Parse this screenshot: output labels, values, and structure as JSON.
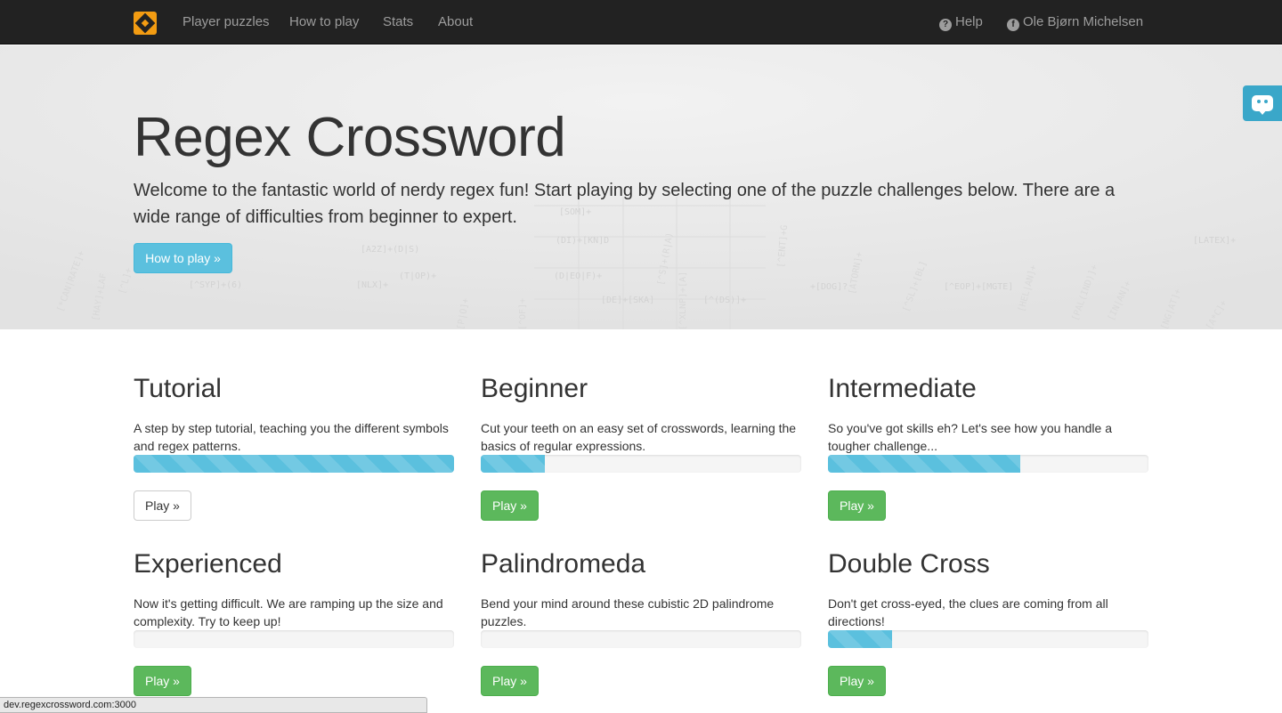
{
  "navbar": {
    "brand_icon": "regex-crossword-logo-icon",
    "links": [
      "Player puzzles",
      "How to play",
      "Stats",
      "About"
    ],
    "help_label": "Help",
    "user_label": "Ole Bjørn Michelsen"
  },
  "hero": {
    "title": "Regex Crossword",
    "text": "Welcome to the fantastic world of nerdy regex fun! Start playing by selecting one of the puzzle challenges below. There are a wide range of difficulties from beginner to expert.",
    "button_label": "How to play »"
  },
  "puzzles": [
    {
      "title": "Tutorial",
      "description": "A step by step tutorial, teaching you the different symbols and regex patterns.",
      "progress": 1.0,
      "button_label": "Play »",
      "button_style": "default"
    },
    {
      "title": "Beginner",
      "description": "Cut your teeth on an easy set of crosswords, learning the basics of regular expressions.",
      "progress": 0.2,
      "button_label": "Play »",
      "button_style": "success"
    },
    {
      "title": "Intermediate",
      "description": "So you've got skills eh? Let's see how you handle a tougher challenge...",
      "progress": 0.6,
      "button_label": "Play »",
      "button_style": "success"
    },
    {
      "title": "Experienced",
      "description": "Now it's getting difficult. We are ramping up the size and complexity. Try to keep up!",
      "progress": 0.0,
      "button_label": "Play »",
      "button_style": "success"
    },
    {
      "title": "Palindromeda",
      "description": "Bend your mind around these cubistic 2D palindrome puzzles.",
      "progress": 0.0,
      "button_label": "Play »",
      "button_style": "success"
    },
    {
      "title": "Double Cross",
      "description": "Don't get cross-eyed, the clues are coming from all directions!",
      "progress": 0.2,
      "button_label": "Play »",
      "button_style": "success"
    }
  ],
  "status_bar": {
    "url": "dev.regexcrossword.com:3000"
  },
  "colors": {
    "navbar": "#222222",
    "info": "#5bc0de",
    "success": "#5cb85c",
    "brand": "#f39c12"
  }
}
